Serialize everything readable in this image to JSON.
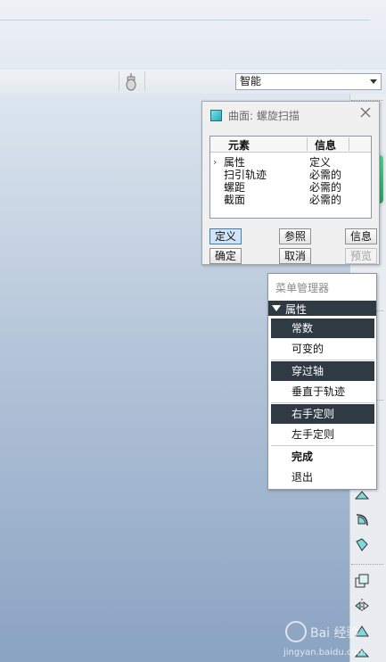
{
  "toolbar": {
    "filter_value": "智能",
    "icons": [
      "mouse-icon"
    ]
  },
  "dialog": {
    "title": "曲面: 螺旋扫描",
    "columns": [
      "元素",
      "信息"
    ],
    "rows": [
      {
        "element": "属性",
        "info": "定义"
      },
      {
        "element": "扫引轨迹",
        "info": "必需的"
      },
      {
        "element": "螺距",
        "info": "必需的"
      },
      {
        "element": "截面",
        "info": "必需的"
      }
    ],
    "buttons": {
      "define": "定义",
      "reference": "参照",
      "info": "信息",
      "ok": "确定",
      "cancel": "取消",
      "preview": "预览"
    }
  },
  "menu": {
    "title": "菜单管理器",
    "section": "属性",
    "items": [
      {
        "label": "常数",
        "selected": true
      },
      {
        "label": "可变的",
        "selected": false
      },
      {
        "label": "穿过轴",
        "selected": true
      },
      {
        "label": "垂直于轨迹",
        "selected": false
      },
      {
        "label": "右手定则",
        "selected": true
      },
      {
        "label": "左手定则",
        "selected": false
      }
    ],
    "done": "完成",
    "exit": "退出"
  },
  "colors": {
    "menu_selected": "#2f3a44",
    "accent_green": "#2fa460",
    "viewport_bottom": "#8aa3c2"
  }
}
